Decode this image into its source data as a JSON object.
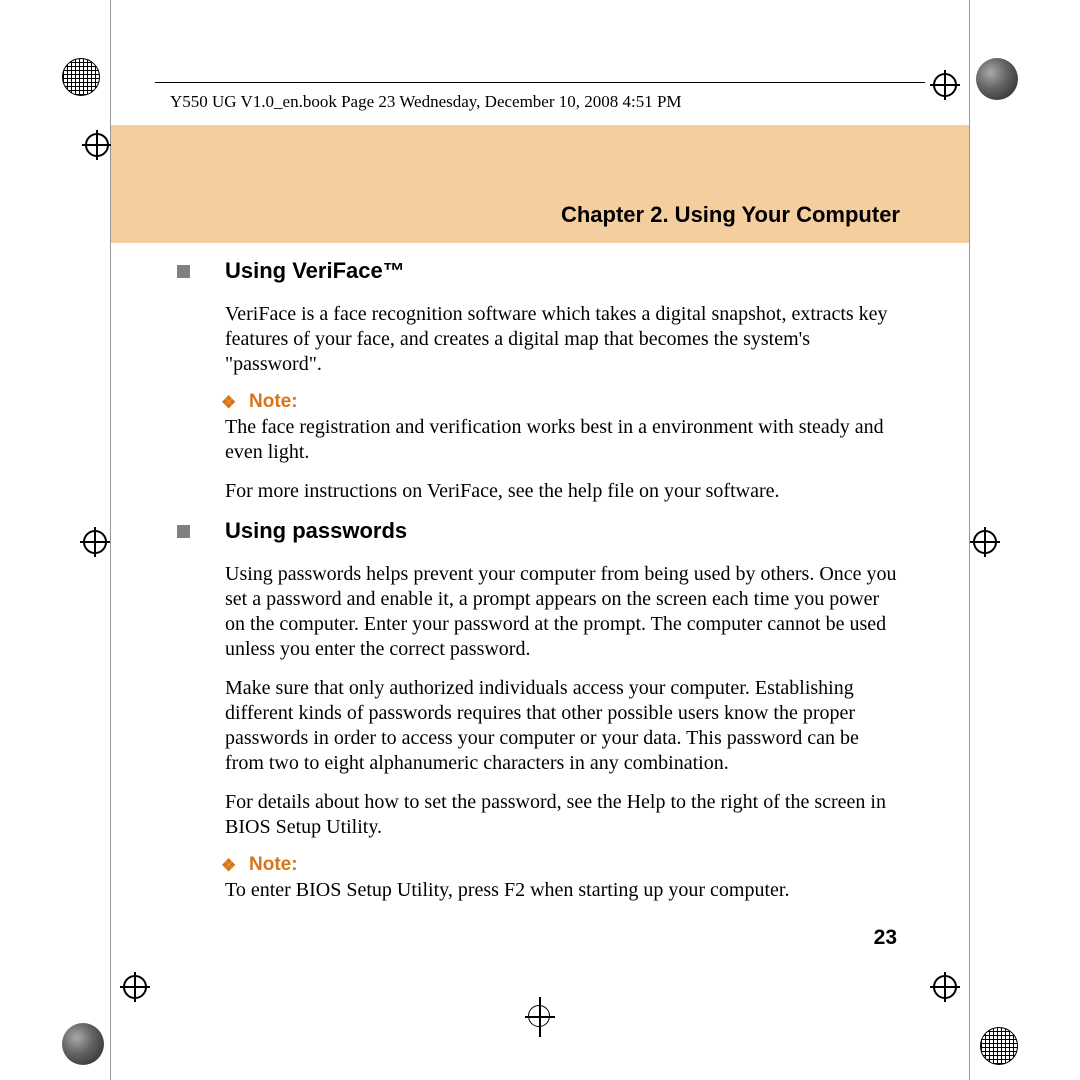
{
  "header": {
    "file_info": "Y550 UG V1.0_en.book  Page 23  Wednesday, December 10, 2008  4:51 PM"
  },
  "chapter": {
    "title": "Chapter 2. Using Your Computer"
  },
  "sections": [
    {
      "heading": "Using VeriFace™",
      "paragraphs": [
        "VeriFace is a face recognition software which takes a digital snapshot, extracts key features of your face, and creates a digital map that becomes the system's \"password\"."
      ],
      "note": {
        "label": "Note:",
        "text": "The face registration and verification works best in a environment with steady and even light."
      },
      "after_note": "For more instructions on VeriFace, see the help file on your software."
    },
    {
      "heading": "Using passwords",
      "paragraphs": [
        "Using passwords helps prevent your computer from being used by others. Once you set a password and enable it, a prompt appears on the screen each time you power on the computer. Enter your password at the prompt. The computer cannot be used unless you enter the correct password.",
        "Make sure that only authorized individuals access your computer. Establishing different kinds of passwords requires that other possible users know the proper passwords in order to access your computer or your data. This password can be from two to eight alphanumeric characters in any combination.",
        "For details about how to set the password, see the Help to the right of the screen in BIOS Setup Utility."
      ],
      "note": {
        "label": "Note:",
        "text": "To enter BIOS Setup Utility, press F2 when starting up your computer."
      }
    }
  ],
  "page_number": "23"
}
